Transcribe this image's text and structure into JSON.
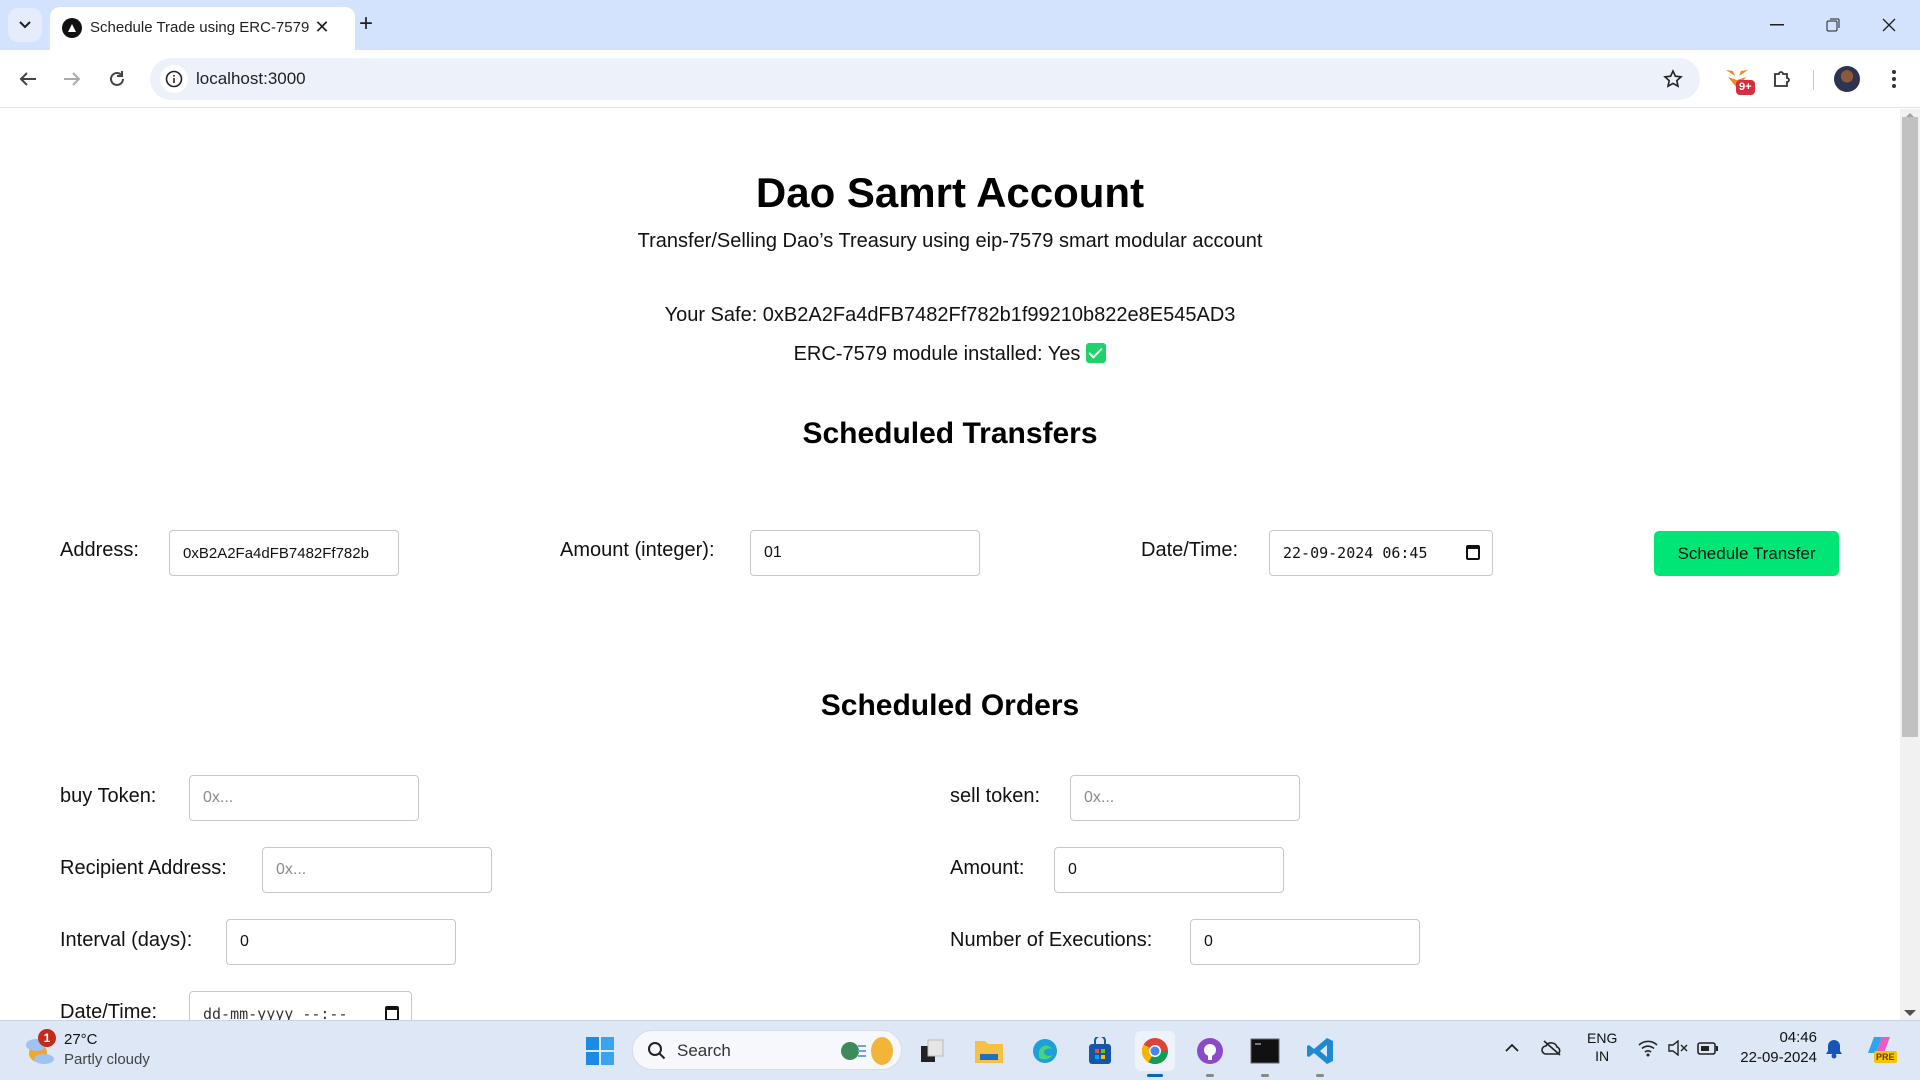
{
  "browser": {
    "tab_title": "Schedule Trade using ERC-7579",
    "url": "localhost:3000",
    "extension_badge": "9+"
  },
  "page": {
    "title": "Dao Samrt Account",
    "subtitle": "Transfer/Selling Dao’s Treasury using eip-7579 smart modular account",
    "safe_line": "Your Safe: 0xB2A2Fa4dFB7482Ff782b1f99210b822e8E545AD3",
    "module_line": "ERC-7579 module installed: Yes",
    "module_installed": true
  },
  "transfers": {
    "heading": "Scheduled Transfers",
    "address_label": "Address:",
    "address_value": "0xB2A2Fa4dFB7482Ff782b",
    "amount_label": "Amount (integer):",
    "amount_value": "01",
    "datetime_label": "Date/Time:",
    "datetime_value": "22-09-2024 06:45",
    "submit_label": "Schedule Transfer"
  },
  "orders": {
    "heading": "Scheduled Orders",
    "buy_token_label": "buy Token:",
    "buy_token_placeholder": "0x...",
    "sell_token_label": "sell token:",
    "sell_token_placeholder": "0x...",
    "recipient_label": "Recipient Address:",
    "recipient_placeholder": "0x...",
    "amount_label": "Amount:",
    "amount_value": "0",
    "interval_label": "Interval (days):",
    "interval_value": "0",
    "executions_label": "Number of Executions:",
    "executions_value": "0",
    "datetime_label": "Date/Time:",
    "datetime_placeholder": "dd-mm-yyyy --:--"
  },
  "colors": {
    "accent_button": "#00e676",
    "check": "#1fd26a"
  },
  "taskbar": {
    "weather_temp": "27°C",
    "weather_condition": "Partly cloudy",
    "weather_badge": "1",
    "search_label": "Search",
    "language": "ENG",
    "region": "IN",
    "time": "04:46",
    "date": "22-09-2024",
    "copilot_badge": "PRE"
  }
}
